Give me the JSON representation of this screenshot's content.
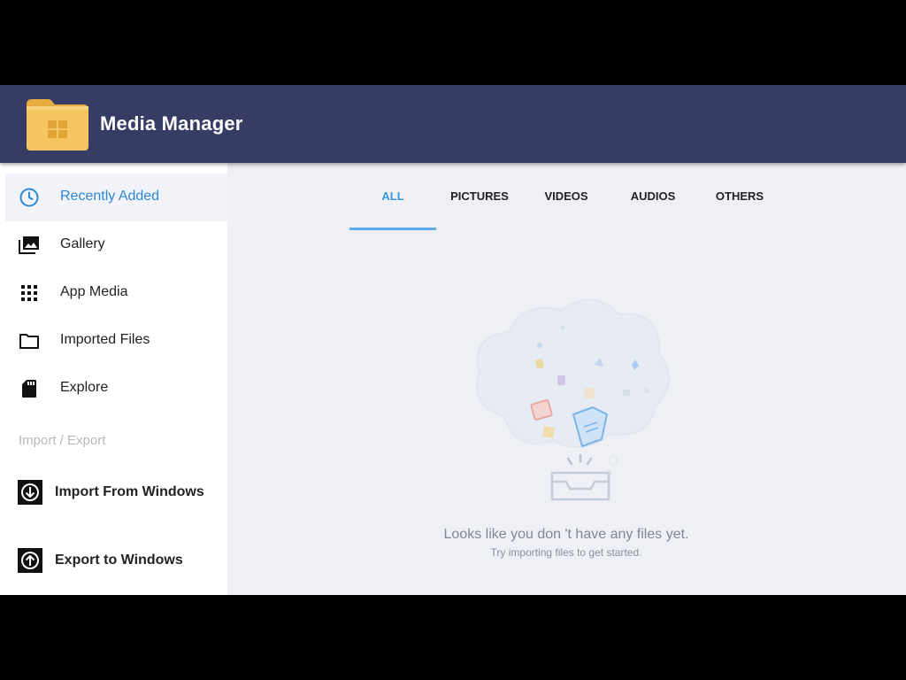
{
  "app": {
    "title": "Media Manager"
  },
  "sidebar": {
    "items": [
      {
        "label": "Recently Added",
        "icon": "clock-icon",
        "active": true
      },
      {
        "label": "Gallery",
        "icon": "gallery-icon",
        "active": false
      },
      {
        "label": "App Media",
        "icon": "grid-icon",
        "active": false
      },
      {
        "label": "Imported Files",
        "icon": "folder-icon",
        "active": false
      },
      {
        "label": "Explore",
        "icon": "sd-card-icon",
        "active": false
      }
    ],
    "section_title": "Import / Export",
    "actions": [
      {
        "label": "Import From Windows",
        "icon": "download-circle-icon"
      },
      {
        "label": "Export to Windows",
        "icon": "upload-circle-icon"
      }
    ]
  },
  "tabs": [
    {
      "label": "ALL",
      "active": true
    },
    {
      "label": "PICTURES",
      "active": false
    },
    {
      "label": "VIDEOS",
      "active": false
    },
    {
      "label": "AUDIOS",
      "active": false
    },
    {
      "label": "OTHERS",
      "active": false
    }
  ],
  "empty_state": {
    "message": "Looks like you don 't have any files yet.",
    "hint": "Try importing files to get started."
  },
  "colors": {
    "header_bg": "#363c63",
    "accent": "#3b97dd",
    "folder": "#f6c561"
  }
}
